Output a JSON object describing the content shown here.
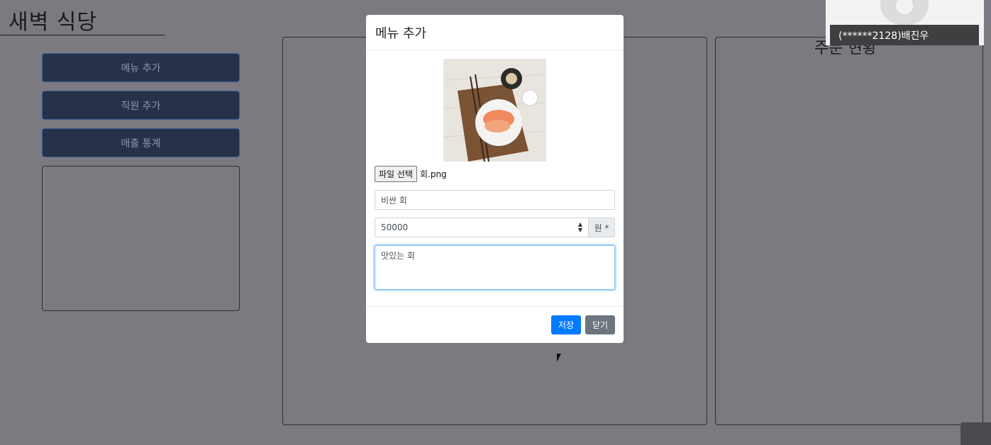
{
  "app": {
    "title": "새벽 식당"
  },
  "sidebar": {
    "buttons": [
      {
        "label": "메뉴 추가"
      },
      {
        "label": "직원 추가"
      },
      {
        "label": "매출 통계"
      }
    ]
  },
  "right_panel": {
    "title": "주문 현황"
  },
  "video": {
    "participant": "(******2128)배진우"
  },
  "modal": {
    "title": "메뉴 추가",
    "file_button": "파일 선택",
    "file_name": "회.png",
    "name_value": "비싼 회",
    "price_value": "50000",
    "price_unit": "원 *",
    "description_value": "맛있는 회",
    "save_label": "저장",
    "close_label": "닫기"
  }
}
